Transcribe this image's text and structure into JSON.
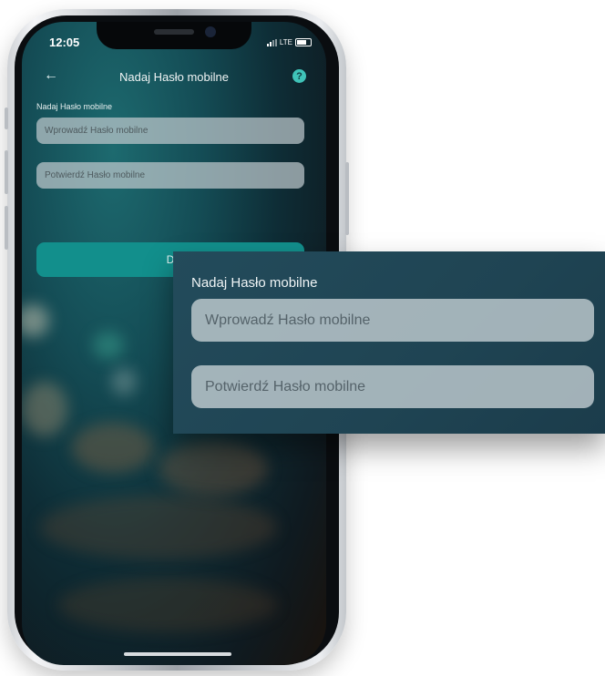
{
  "status_bar": {
    "time": "12:05",
    "network": "LTE"
  },
  "nav": {
    "back_icon": "arrow-left-icon",
    "title": "Nadaj Hasło mobilne",
    "help_icon": "question-icon",
    "help_glyph": "?"
  },
  "form": {
    "label": "Nadaj Hasło mobilne",
    "password_placeholder": "Wprowadź Hasło mobilne",
    "confirm_placeholder": "Potwierdź Hasło mobilne",
    "submit_label_visible": "D"
  },
  "zoom_panel": {
    "label": "Nadaj Hasło mobilne",
    "password_placeholder": "Wprowadź Hasło mobilne",
    "confirm_placeholder": "Potwierdź Hasło mobilne"
  },
  "colors": {
    "accent": "#3fc3b8",
    "button": "#128f8c",
    "field": "#bec8cc"
  }
}
